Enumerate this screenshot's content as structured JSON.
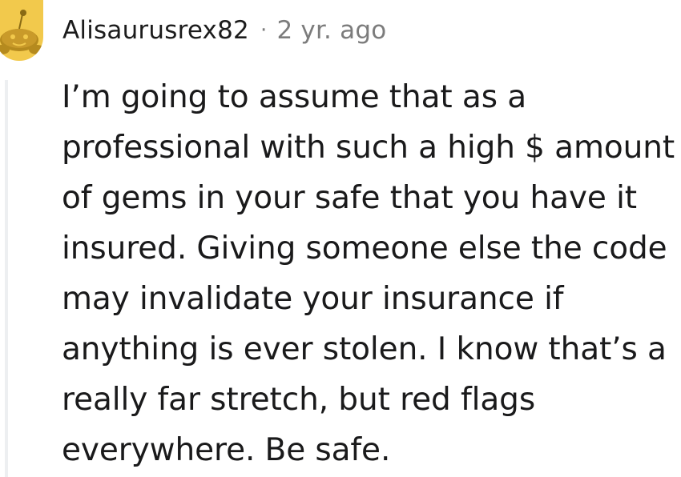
{
  "comment": {
    "author": "Alisaurusrex82",
    "separator": "·",
    "timestamp": "2 yr. ago",
    "avatar_icon": "snoo-avatar-icon",
    "accent": "#f2c94c",
    "body": "I’m going to assume that as a professional with such a high $ amount of gems in your safe that you have it insured. Giving someone else the code may invalidate your insurance if anything is ever stolen. I know that’s a really far stretch, but red flags everywhere. Be safe."
  }
}
